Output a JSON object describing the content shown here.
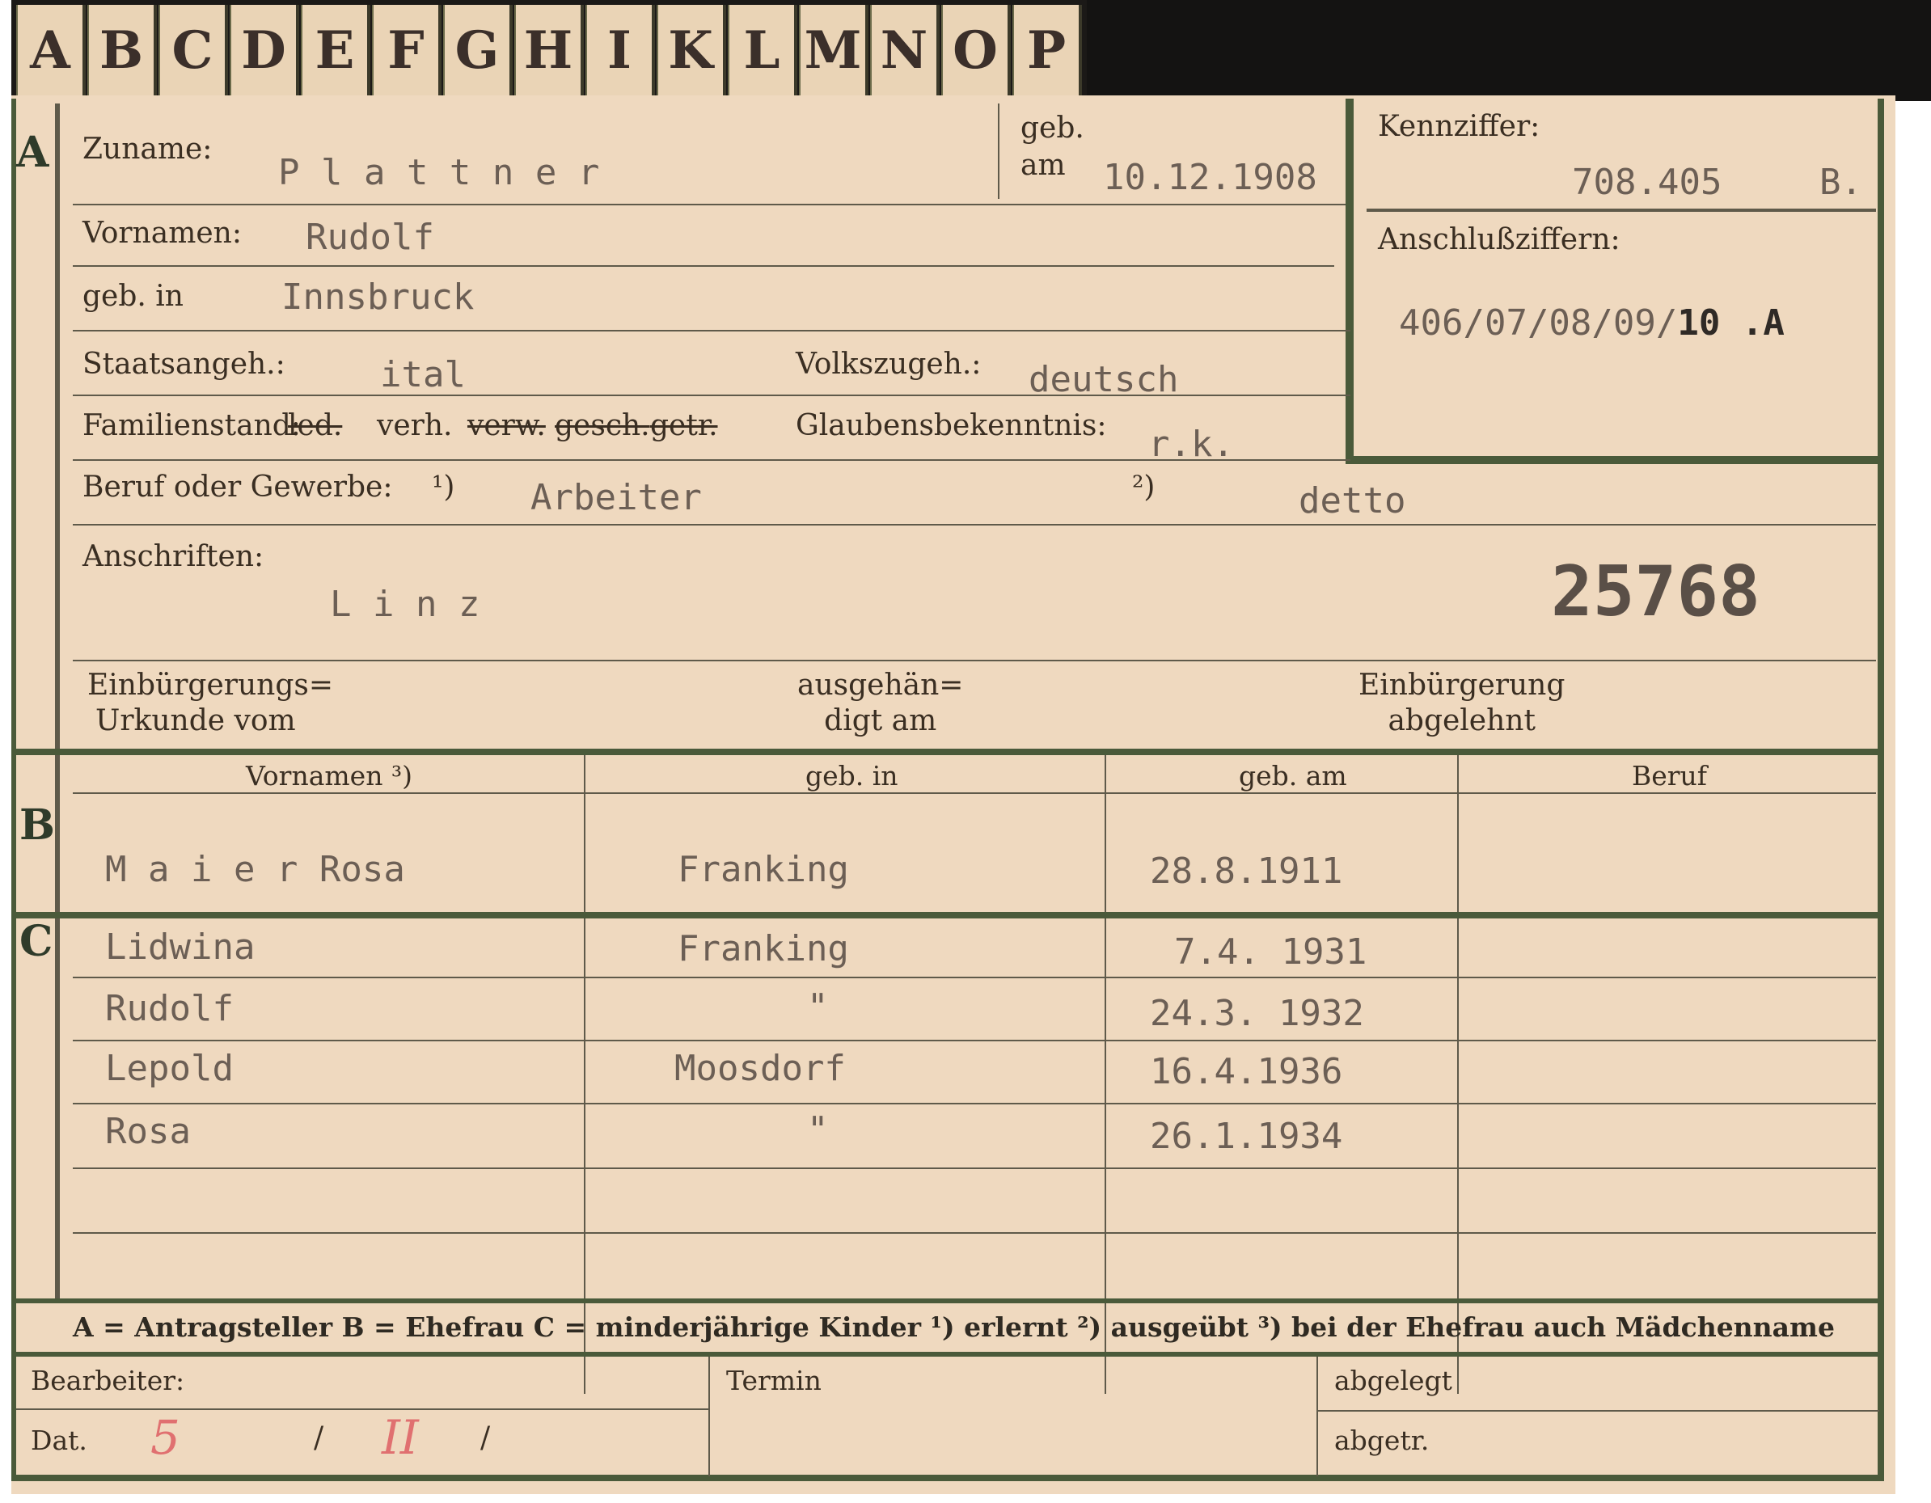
{
  "tabs": [
    "A",
    "B",
    "C",
    "D",
    "E",
    "F",
    "G",
    "H",
    "I",
    "K",
    "L",
    "M",
    "N",
    "O",
    "P"
  ],
  "section_a": {
    "marker": "A",
    "zuname_label": "Zuname:",
    "zuname_value": "P l a t t n e r",
    "geb_am_label": "geb.\nam",
    "geb_am_value": "10.12.1908",
    "kennziffer_label": "Kennziffer:",
    "kennziffer_value": "708.405",
    "kennziffer_suffix": "B.",
    "anschluss_label": "Anschlußziffern:",
    "anschluss_value": "406/07/08/09/",
    "anschluss_value_bold": "10 .A",
    "vornamen_label": "Vornamen:",
    "vornamen_value": "Rudolf",
    "geb_in_label": "geb. in",
    "geb_in_value": "Innsbruck",
    "staatsangeh_label": "Staatsangeh.:",
    "staatsangeh_value": "ital",
    "volkszugeh_label": "Volkszugeh.:",
    "volkszugeh_value": "deutsch",
    "familienstand_label": "Familienstand:",
    "familienstand_options": [
      "led.",
      "verh.",
      "verw.",
      "gesch.",
      "getr."
    ],
    "glaubens_label": "Glaubensbekenntnis:",
    "glaubens_value": "r.k.",
    "beruf_label": "Beruf oder Gewerbe:",
    "beruf_mark1": "¹)",
    "beruf_value1": "Arbeiter",
    "beruf_mark2": "²)",
    "beruf_value2": "detto",
    "anschriften_label": "Anschriften:",
    "anschriften_value": "L i n z",
    "stamp_number": "25768",
    "einb_urkunde_label_1": "Einbürgerungs=",
    "einb_urkunde_label_2": "Urkunde vom",
    "ausgehaen_label_1": "ausgehän=",
    "ausgehaen_label_2": "digt am",
    "einb_abgelehnt_label_1": "Einbürgerung",
    "einb_abgelehnt_label_2": "abgelehnt"
  },
  "table_headers": {
    "vornamen": "Vornamen ³)",
    "geb_in": "geb. in",
    "geb_am": "geb. am",
    "beruf": "Beruf"
  },
  "section_b": {
    "marker": "B",
    "name": "M a i e r   Rosa",
    "geb_in": "Franking",
    "geb_am": "28.8.1911",
    "beruf": ""
  },
  "section_c": {
    "marker": "C",
    "children": [
      {
        "name": "Lidwina",
        "geb_in": "Franking",
        "geb_am": "7.4. 1931"
      },
      {
        "name": "Rudolf",
        "geb_in": "\"",
        "geb_am": "24.3. 1932"
      },
      {
        "name": "Lepold",
        "geb_in": "Moosdorf",
        "geb_am": "16.4.1936"
      },
      {
        "name": "Rosa",
        "geb_in": "\"",
        "geb_am": "26.1.1934"
      }
    ]
  },
  "legend": "A = Antragsteller   B = Ehefrau   C = minderjährige Kinder   ¹) erlernt   ²) ausgeübt   ³) bei der Ehefrau auch Mädchenname",
  "footer": {
    "bearbeiter_label": "Bearbeiter:",
    "dat_label": "Dat.",
    "dat_value_1": "5",
    "dat_sep_1": "/",
    "dat_value_2": "II",
    "dat_sep_2": "/",
    "termin_label": "Termin",
    "abgelegt_label": "abgelegt",
    "abgetr_label": "abgetr."
  },
  "colors": {
    "card": "#efd9bf",
    "tab": "#ead4b6",
    "line": "#5f5a4a",
    "green_line": "#4a5a3a",
    "red_pencil": "#e07070",
    "type": "#6c5f55"
  }
}
